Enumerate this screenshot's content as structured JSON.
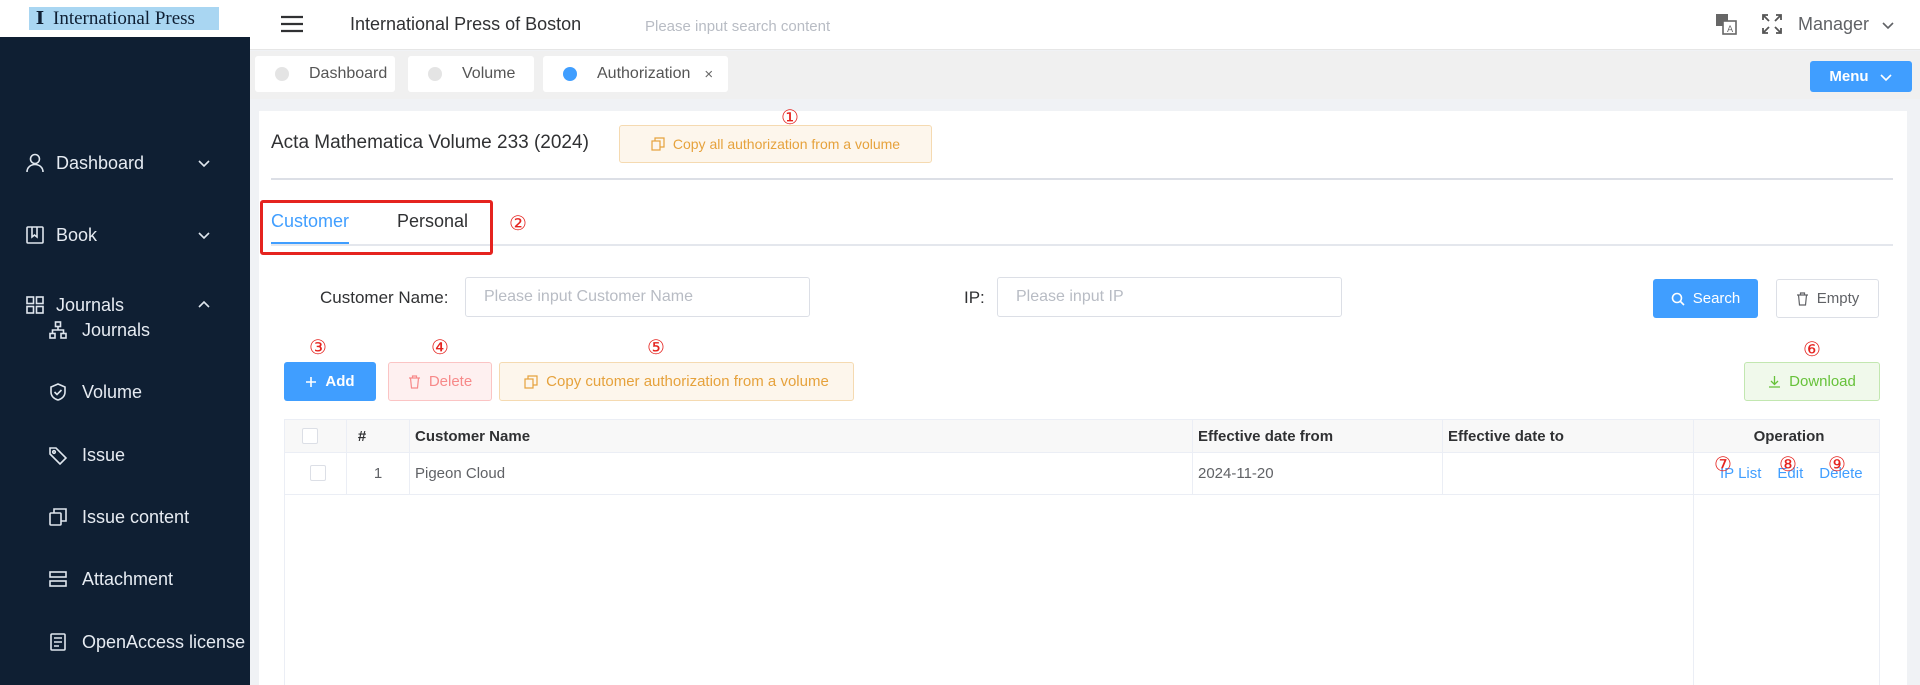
{
  "app": {
    "logo_mark": "I",
    "logo_text": "International Press",
    "title": "International Press of Boston",
    "search_placeholder": "Please input search content",
    "user": "Manager"
  },
  "sidebar": {
    "items": [
      {
        "label": "Dashboard",
        "icon": "user-icon",
        "expanded": false
      },
      {
        "label": "Book",
        "icon": "book-icon",
        "expanded": false
      },
      {
        "label": "Journals",
        "icon": "grid-icon",
        "expanded": true
      }
    ],
    "subitems": [
      {
        "label": "Journals",
        "icon": "sitemap-icon"
      },
      {
        "label": "Volume",
        "icon": "shield-icon"
      },
      {
        "label": "Issue",
        "icon": "tag-icon"
      },
      {
        "label": "Issue content",
        "icon": "copy-icon"
      },
      {
        "label": "Attachment",
        "icon": "stack-icon"
      },
      {
        "label": "OpenAccess license",
        "icon": "document-icon"
      }
    ]
  },
  "tabs": [
    {
      "label": "Dashboard",
      "active": false
    },
    {
      "label": "Volume",
      "active": false
    },
    {
      "label": "Authorization",
      "active": true,
      "closable": true,
      "close": "×"
    }
  ],
  "menu_button": "Menu",
  "page": {
    "title": "Acta Mathematica Volume 233 (2024)",
    "copy_all_label": "Copy all authorization from a volume",
    "type_tabs": [
      "Customer",
      "Personal"
    ],
    "filters": {
      "customer_name_label": "Customer Name:",
      "customer_name_placeholder": "Please input Customer Name",
      "ip_label": "IP:",
      "ip_placeholder": "Please input IP",
      "search_label": "Search",
      "empty_label": "Empty"
    },
    "actions": {
      "add": "Add",
      "delete": "Delete",
      "copy_customer": "Copy cutomer authorization from a volume",
      "download": "Download"
    },
    "markers": [
      "①",
      "②",
      "③",
      "④",
      "⑤",
      "⑥",
      "⑦",
      "⑧",
      "⑨"
    ],
    "table": {
      "headers": [
        "#",
        "Customer Name",
        "Effective date from",
        "Effective date to",
        "Operation"
      ],
      "rows": [
        {
          "index": "1",
          "customer_name": "Pigeon Cloud",
          "date_from": "2024-11-20",
          "date_to": "",
          "ops": [
            "IP List",
            "Edit",
            "Delete"
          ]
        }
      ]
    }
  },
  "colors": {
    "sidebar_bg": "#0f1f33",
    "primary": "#409eff",
    "warning": "#e6a23c",
    "danger": "#f78989",
    "success": "#67c23a",
    "annotation_red": "#e5231f"
  }
}
